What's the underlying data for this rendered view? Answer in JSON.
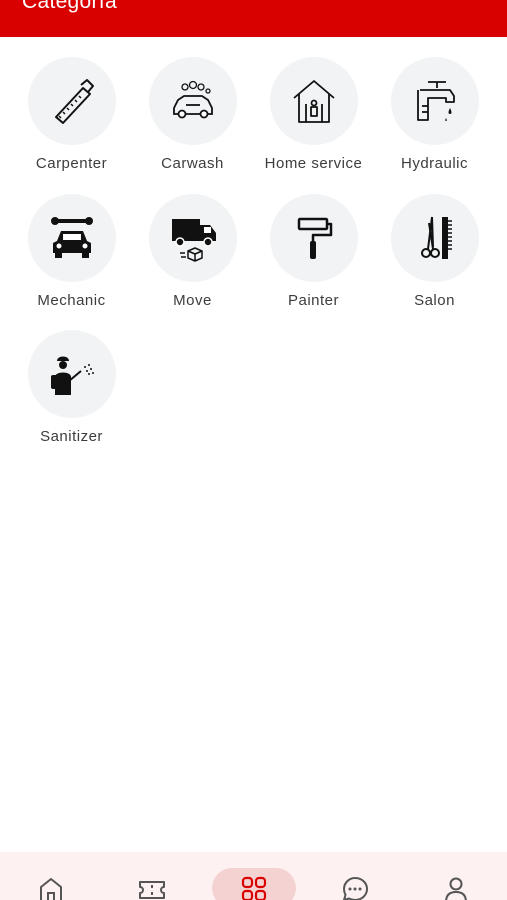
{
  "header": {
    "title": "Categoría",
    "background_color": "#d90000"
  },
  "categories": [
    {
      "label": "Carpenter",
      "icon": "saw-icon"
    },
    {
      "label": "Carwash",
      "icon": "carwash-icon"
    },
    {
      "label": "Home service",
      "icon": "home-service-icon"
    },
    {
      "label": "Hydraulic",
      "icon": "faucet-icon"
    },
    {
      "label": "Mechanic",
      "icon": "car-wrench-icon"
    },
    {
      "label": "Move",
      "icon": "moving-truck-icon"
    },
    {
      "label": "Painter",
      "icon": "paint-roller-icon"
    },
    {
      "label": "Salon",
      "icon": "scissors-comb-icon"
    },
    {
      "label": "Sanitizer",
      "icon": "sprayer-person-icon"
    }
  ],
  "bottom_nav": {
    "items": [
      {
        "icon": "home-icon",
        "active": false
      },
      {
        "icon": "ticket-icon",
        "active": false
      },
      {
        "icon": "categories-grid-icon",
        "active": true
      },
      {
        "icon": "chat-icon",
        "active": false
      },
      {
        "icon": "profile-icon",
        "active": false
      }
    ],
    "active_color": "#d90000"
  }
}
